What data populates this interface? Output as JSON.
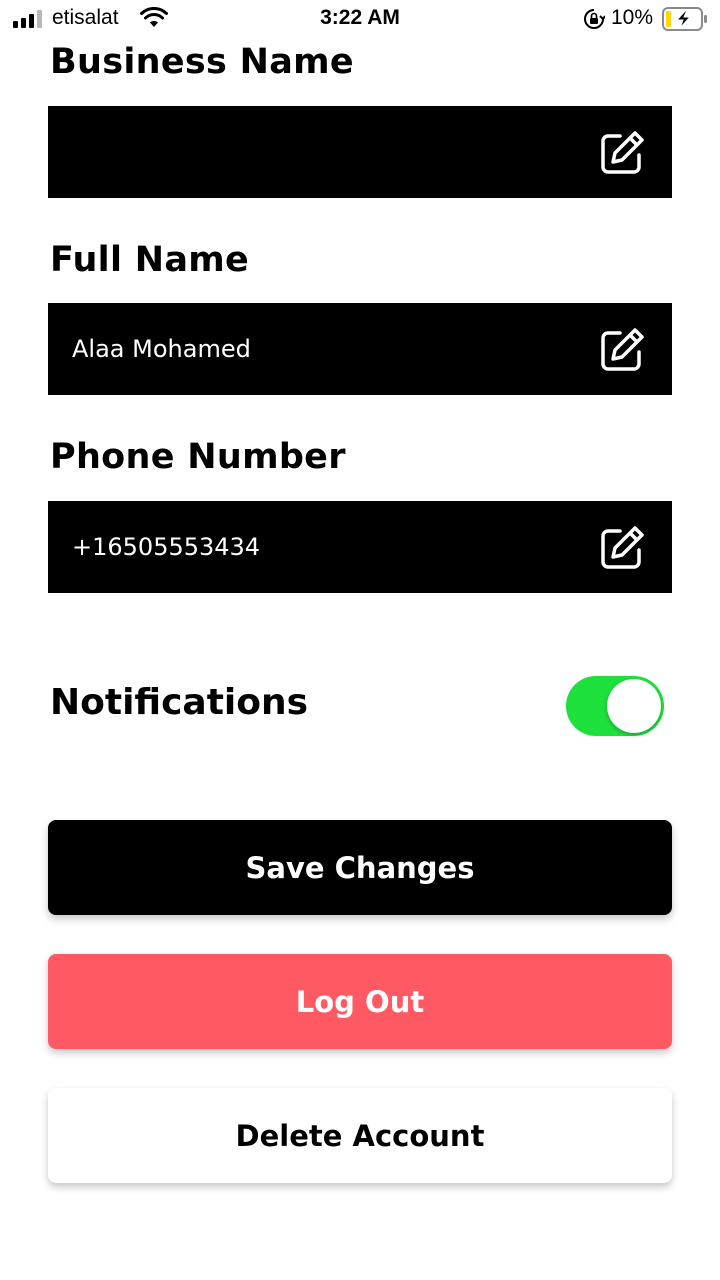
{
  "status_bar": {
    "carrier": "etisalat",
    "time": "3:22 AM",
    "battery_percent": "10%",
    "icons": [
      "signal-icon",
      "wifi-icon",
      "orientation-lock-icon",
      "battery-charging-icon"
    ]
  },
  "form": {
    "business_name": {
      "label": "Business Name",
      "value": ""
    },
    "full_name": {
      "label": "Full Name",
      "value": "Alaa Mohamed"
    },
    "phone_number": {
      "label": "Phone Number",
      "value": "+16505553434"
    },
    "edit_icon": "edit-icon"
  },
  "notifications": {
    "label": "Notifications",
    "enabled": true,
    "toggle_color": "#1ee03c"
  },
  "buttons": {
    "save": "Save Changes",
    "logout": "Log Out",
    "delete": "Delete Account"
  },
  "colors": {
    "field_background": "#000000",
    "logout": "#ff5a64",
    "save": "#000000"
  }
}
